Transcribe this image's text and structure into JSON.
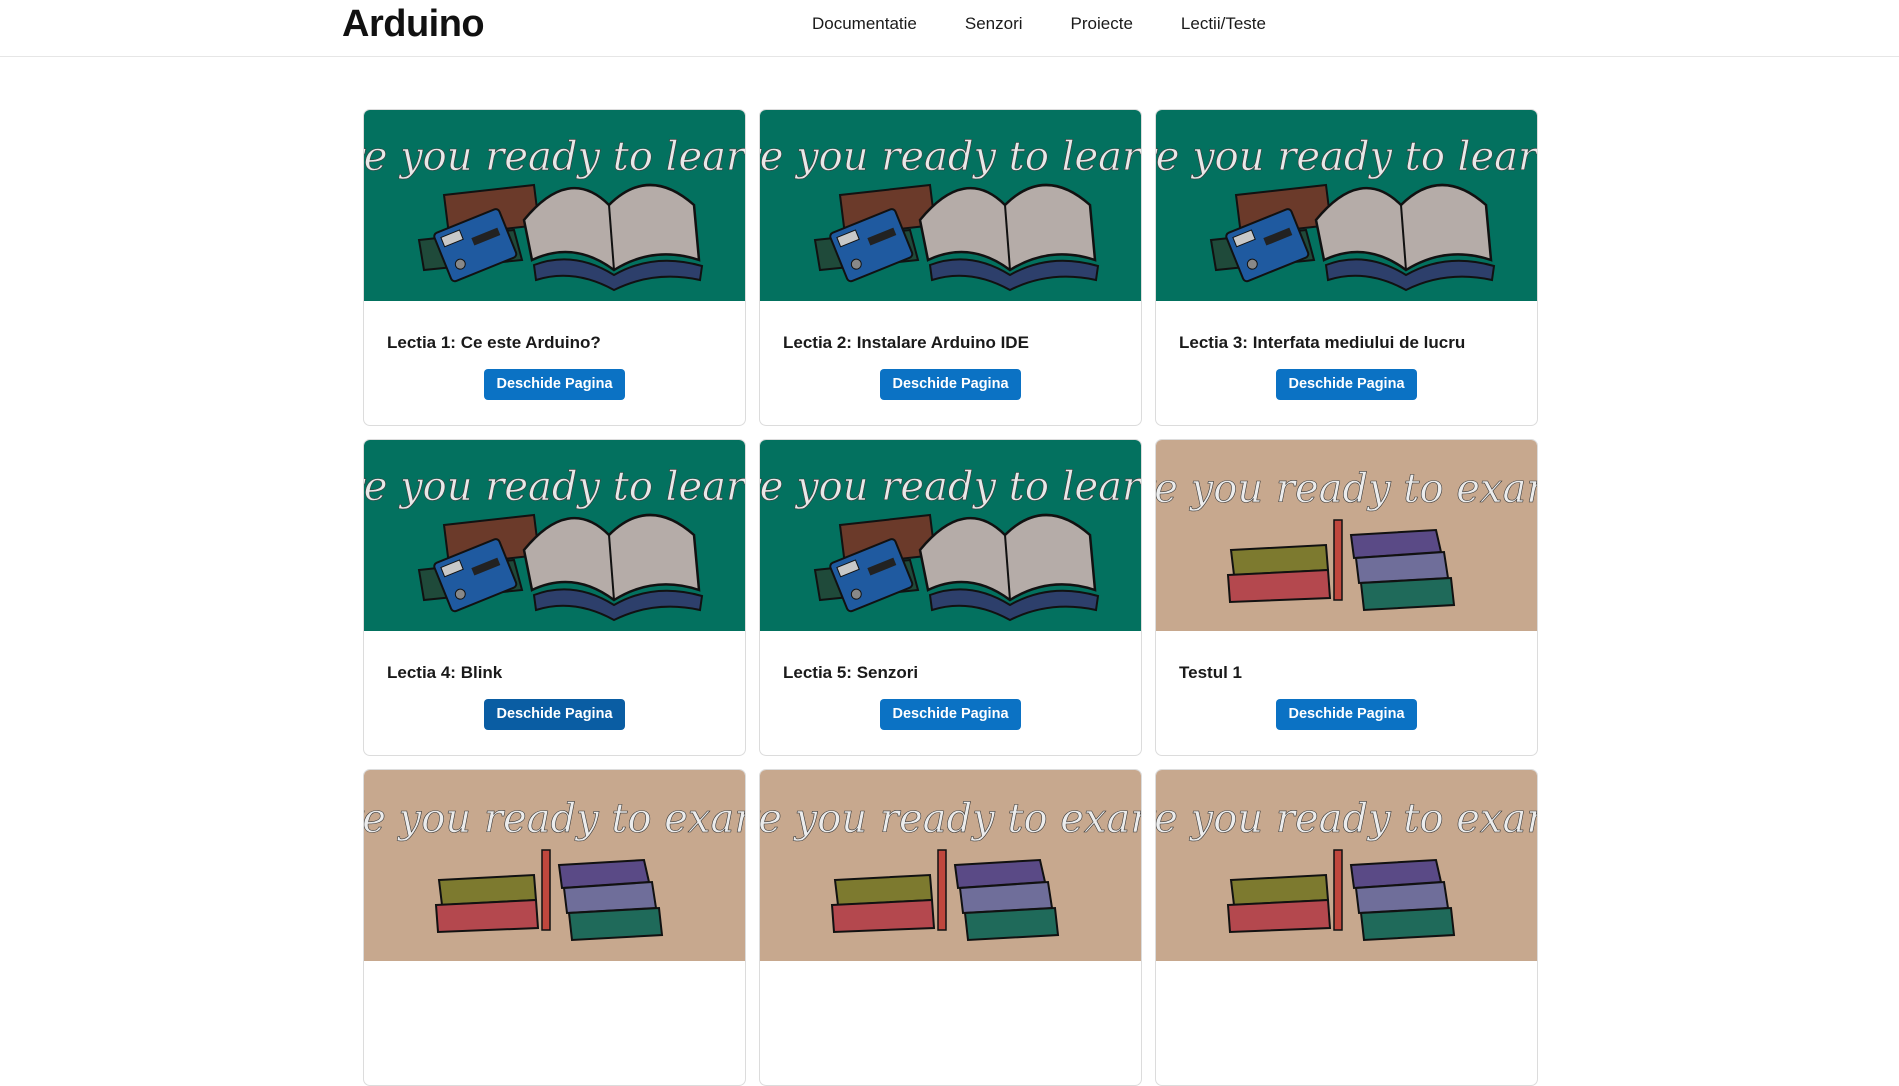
{
  "brand": "Arduino",
  "nav": [
    {
      "label": "Documentatie"
    },
    {
      "label": "Senzori"
    },
    {
      "label": "Proiecte"
    },
    {
      "label": "Lectii/Teste"
    }
  ],
  "banners": {
    "learn": "Are you ready to learn?",
    "exam": "Are you ready to exam?"
  },
  "colors": {
    "learn_bg": "#03715f",
    "exam_bg": "#c7a88e",
    "button": "#0b72c4"
  },
  "cards": [
    {
      "title": "Lectia 1: Ce este Arduino?",
      "button": "Deschide Pagina",
      "image": "learn"
    },
    {
      "title": "Lectia 2: Instalare Arduino IDE",
      "button": "Deschide Pagina",
      "image": "learn"
    },
    {
      "title": "Lectia 3: Interfata mediului de lucru",
      "button": "Deschide Pagina",
      "image": "learn"
    },
    {
      "title": "Lectia 4: Blink",
      "button": "Deschide Pagina",
      "image": "learn"
    },
    {
      "title": "Lectia 5: Senzori",
      "button": "Deschide Pagina",
      "image": "learn"
    },
    {
      "title": "Testul 1",
      "button": "Deschide Pagina",
      "image": "exam"
    },
    {
      "title": "",
      "button": "",
      "image": "exam"
    },
    {
      "title": "",
      "button": "",
      "image": "exam"
    },
    {
      "title": "",
      "button": "",
      "image": "exam"
    }
  ]
}
